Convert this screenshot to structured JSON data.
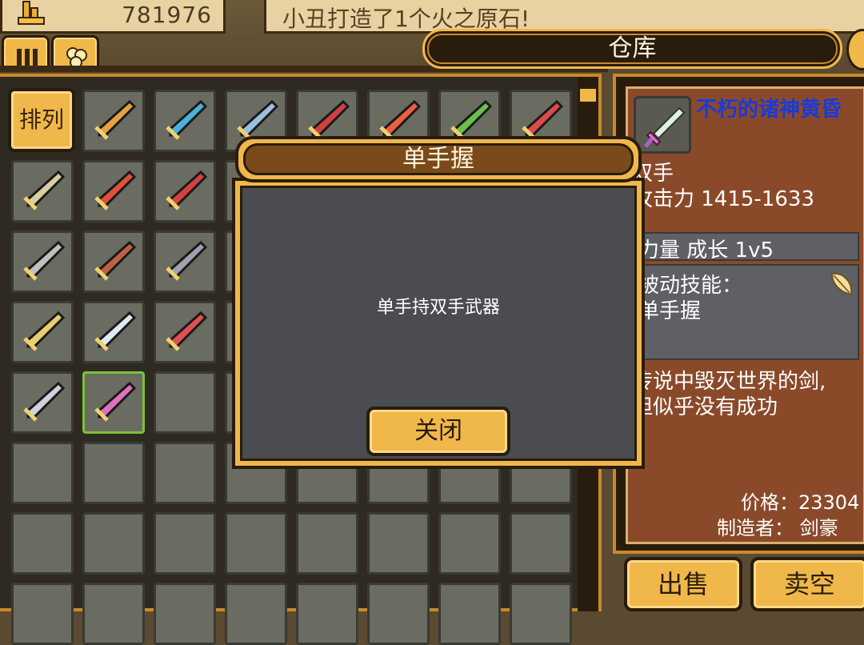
{
  "header": {
    "gold_icon": "gold-coin-stack-icon",
    "gold_value": "781976",
    "message": "小丑打造了1个火之原石!"
  },
  "tabs": [
    {
      "icon": "pillar-icon"
    },
    {
      "icon": "gem-cluster-icon"
    }
  ],
  "warehouse": {
    "title": "仓库"
  },
  "inventory": {
    "sort_label": "排列",
    "items": [
      {
        "icon": "sun-scepter-icon",
        "color": "#e8a040"
      },
      {
        "icon": "blue-wand-icon",
        "color": "#4ab0e0"
      },
      {
        "icon": "pickaxe-icon",
        "color": "#9ac0e0"
      },
      {
        "icon": "red-scepter-icon",
        "color": "#d04040"
      },
      {
        "icon": "flame-sword-icon",
        "color": "#e86040"
      },
      {
        "icon": "green-axe-icon",
        "color": "#6ac04a"
      },
      {
        "icon": "red-ribbon-icon",
        "color": "#e04a4a"
      },
      {
        "icon": "mace-icon",
        "color": "#d8d0a0"
      },
      {
        "icon": "fire-staff-icon",
        "color": "#e0503a"
      },
      {
        "icon": "crimson-sword-icon",
        "color": "#d84040"
      },
      {
        "icon": "blue-dagger-icon",
        "color": "#6ab0f0"
      },
      {
        "icon": "ruby-ring-icon",
        "color": "#e8c030"
      },
      {
        "icon": "twisted-dagger-icon",
        "color": "#c080c0"
      },
      {
        "icon": "violet-dagger-icon",
        "color": "#b080f0"
      },
      {
        "icon": "sapphire-sword-icon",
        "color": "#60a8f0"
      },
      {
        "icon": "silver-chain-icon",
        "color": "#c0c0c0"
      },
      {
        "icon": "bronze-helmet-icon",
        "color": "#c06040"
      },
      {
        "icon": "knight-helmet-icon",
        "color": "#a0a0b0"
      },
      {
        "icon": "golden-blade-icon",
        "color": "#e8d070"
      },
      {
        "icon": "silver-shield-icon",
        "color": "#e0e8f0"
      },
      {
        "icon": "winged-armor-icon",
        "color": "#e05050"
      },
      {
        "icon": "crystal-orb-icon",
        "color": "#d0d0e0"
      },
      {
        "icon": "pink-crystal-sword-icon",
        "color": "#e070c0"
      }
    ]
  },
  "detail": {
    "name": "不朽的诸神黄昏",
    "type": "双手",
    "attack": "攻击力 1415-1633",
    "stat": "力量 成长 1v5",
    "passive_label": "被动技能：",
    "passive_skill": "单手握",
    "passive_icon": "feather-quill-icon",
    "desc_line1": "传说中毁灭世界的剑,",
    "desc_line2": "但似乎没有成功",
    "price": "价格：23304",
    "maker": "制造者：  剑豪"
  },
  "modal": {
    "title": "单手握",
    "message": "单手持双手武器",
    "close_label": "关闭"
  },
  "actions": {
    "sell_label": "出售",
    "sell_all_label": "卖空"
  }
}
